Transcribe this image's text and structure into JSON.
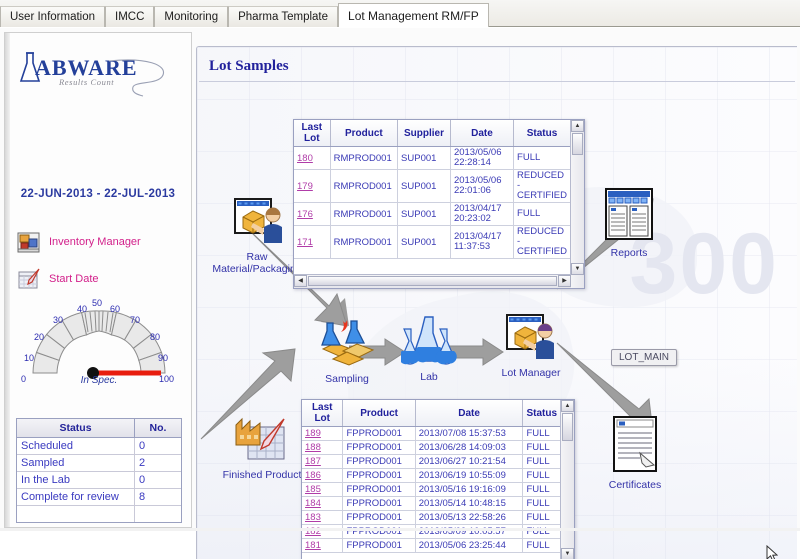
{
  "window": {
    "tabs": [
      {
        "label": "User Information",
        "selected": false
      },
      {
        "label": "IMCC",
        "selected": false
      },
      {
        "label": "Monitoring",
        "selected": false
      },
      {
        "label": "Pharma Template",
        "selected": false
      },
      {
        "label": "Lot Management RM/FP",
        "selected": true
      }
    ]
  },
  "sidebar": {
    "logo": {
      "word": "ABWARE",
      "initial": "L",
      "tagline": "Results Count"
    },
    "date_range": "22-JUN-2013 - 22-JUL-2013",
    "links": [
      {
        "label": "Inventory Manager",
        "icon": "inventory-manager-icon"
      },
      {
        "label": "Start Date",
        "icon": "calendar-pen-icon"
      }
    ],
    "gauge": {
      "caption": "In Spec.",
      "ticks": [
        "0",
        "10",
        "20",
        "30",
        "40",
        "50",
        "60",
        "70",
        "80",
        "90",
        "100"
      ],
      "value": 100,
      "needle_color": "#e81d0e"
    },
    "status_table": {
      "headers": [
        "Status",
        "No."
      ],
      "rows": [
        {
          "status": "Scheduled",
          "no": "0"
        },
        {
          "status": "Sampled",
          "no": "2"
        },
        {
          "status": "In the Lab",
          "no": "0"
        },
        {
          "status": "Complete for review",
          "no": "8"
        }
      ]
    }
  },
  "main": {
    "title": "Lot Samples",
    "watermark": "300",
    "tooltip": "LOT_MAIN",
    "nodes": [
      {
        "id": "raw-material",
        "label": "Raw\nMaterial/Packaging",
        "icon": "package-operator-icon"
      },
      {
        "id": "sampling",
        "label": "Sampling",
        "icon": "sampling-icon"
      },
      {
        "id": "lab",
        "label": "Lab",
        "icon": "flasks-icon"
      },
      {
        "id": "lot-manager",
        "label": "Lot Manager",
        "icon": "package-operator-icon"
      },
      {
        "id": "reports",
        "label": "Reports",
        "icon": "reports-icon"
      },
      {
        "id": "certificates",
        "label": "Certificates",
        "icon": "certificate-icon"
      },
      {
        "id": "finished-product",
        "label": "Finished Product",
        "icon": "factory-calendar-icon"
      }
    ],
    "grid_top": {
      "headers": [
        "Last Lot",
        "Product",
        "Supplier",
        "Date",
        "Status"
      ],
      "rows": [
        {
          "lot": "180",
          "product": "RMPROD001",
          "supplier": "SUP001",
          "date": "2013/05/06 22:28:14",
          "status": "FULL"
        },
        {
          "lot": "179",
          "product": "RMPROD001",
          "supplier": "SUP001",
          "date": "2013/05/06 22:01:06",
          "status": "REDUCED - CERTIFIED"
        },
        {
          "lot": "176",
          "product": "RMPROD001",
          "supplier": "SUP001",
          "date": "2013/04/17 20:23:02",
          "status": "FULL"
        },
        {
          "lot": "171",
          "product": "RMPROD001",
          "supplier": "SUP001",
          "date": "2013/04/17 11:37:53",
          "status": "REDUCED - CERTIFIED"
        }
      ]
    },
    "grid_bottom": {
      "headers": [
        "Last Lot",
        "Product",
        "Date",
        "Status"
      ],
      "rows": [
        {
          "lot": "189",
          "product": "FPPROD001",
          "date": "2013/07/08 15:37:53",
          "status": "FULL"
        },
        {
          "lot": "188",
          "product": "FPPROD001",
          "date": "2013/06/28 14:09:03",
          "status": "FULL"
        },
        {
          "lot": "187",
          "product": "FPPROD001",
          "date": "2013/06/27 10:21:54",
          "status": "FULL"
        },
        {
          "lot": "186",
          "product": "FPPROD001",
          "date": "2013/06/19 10:55:09",
          "status": "FULL"
        },
        {
          "lot": "185",
          "product": "FPPROD001",
          "date": "2013/05/16 19:16:09",
          "status": "FULL"
        },
        {
          "lot": "184",
          "product": "FPPROD001",
          "date": "2013/05/14 10:48:15",
          "status": "FULL"
        },
        {
          "lot": "183",
          "product": "FPPROD001",
          "date": "2013/05/13 22:58:26",
          "status": "FULL"
        },
        {
          "lot": "182",
          "product": "FPPROD001",
          "date": "2013/05/09 10:05:57",
          "status": "FULL"
        },
        {
          "lot": "181",
          "product": "FPPROD001",
          "date": "2013/05/06 23:25:44",
          "status": "FULL"
        }
      ]
    }
  },
  "colors": {
    "accent_blue": "#21219c",
    "link_magenta": "#b03ca8",
    "text_blue": "#3a3ab5",
    "pink": "#d21f8a"
  }
}
